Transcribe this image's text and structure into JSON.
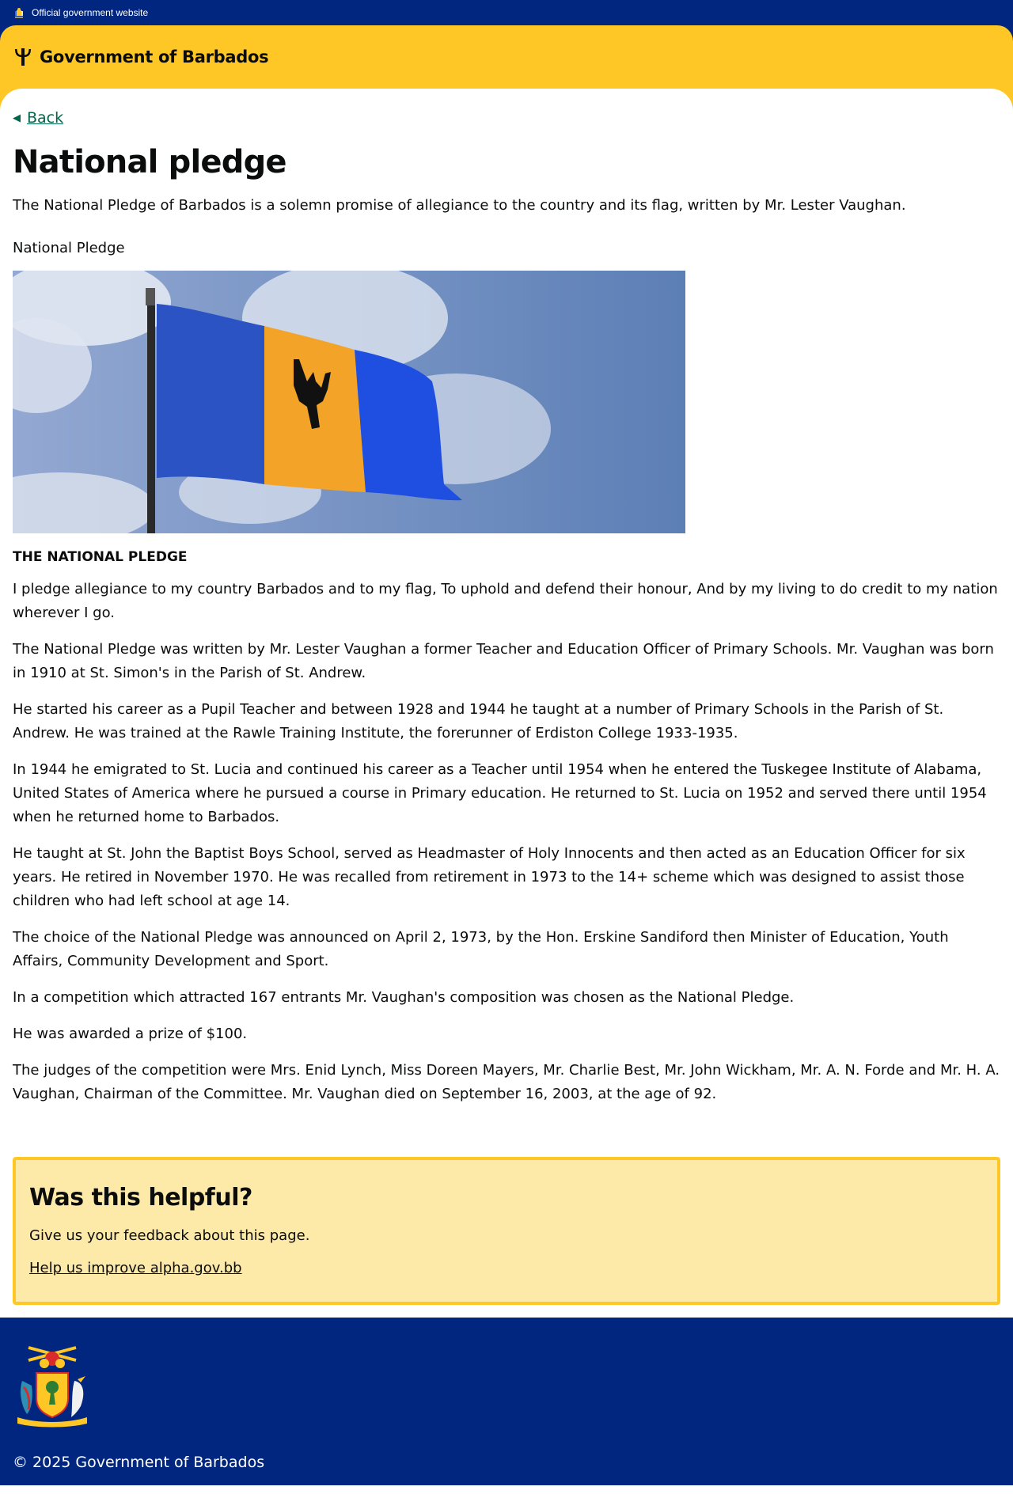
{
  "topbar": {
    "label": "Official government website",
    "crest_icon": "coat-of-arms-icon"
  },
  "header": {
    "brand": "Government of Barbados",
    "icon": "trident-icon"
  },
  "nav": {
    "back_label": "Back"
  },
  "page": {
    "title": "National pledge",
    "lead": "The National Pledge of Barbados is a solemn promise of allegiance to the country and its flag, written by Mr. Lester Vaughan.",
    "image_caption": "National Pledge",
    "pledge_heading": "THE NATIONAL PLEDGE",
    "paragraphs": [
      "I pledge allegiance to my country Barbados and to my flag, To uphold and defend their honour, And by my living to do credit to my nation wherever I go.",
      "The National Pledge was written by Mr. Lester Vaughan a former Teacher and Education Officer of Primary Schools. Mr. Vaughan was born in 1910 at St. Simon's in the Parish of St. Andrew.",
      "He started his career as a Pupil Teacher and between 1928 and 1944 he taught at a number of Primary Schools in the Parish of St. Andrew. He was trained at the Rawle Training Institute, the forerunner of Erdiston College 1933-1935.",
      "In 1944 he emigrated to St. Lucia and continued his career as a Teacher until 1954 when he entered the Tuskegee Institute of Alabama, United States of America where he pursued a course in Primary education. He returned to St. Lucia on 1952 and served there until 1954 when he returned home to Barbados.",
      "He taught at St. John the Baptist Boys School, served as Headmaster of Holy Innocents and then acted as an Education Officer for six years. He retired in November 1970. He was recalled from retirement in 1973 to the 14+ scheme which was designed to assist those children who had left school at age 14.",
      "The choice of the National Pledge was announced on April 2, 1973, by the Hon. Erskine Sandiford then Minister of Education, Youth Affairs, Community Development and Sport.",
      "In a competition which attracted 167 entrants Mr. Vaughan's composition was chosen as the National Pledge.",
      "He was awarded a prize of $100.",
      "The judges of the competition were Mrs. Enid Lynch, Miss Doreen Mayers, Mr. Charlie Best, Mr. John Wickham, Mr. A. N. Forde and Mr. H. A. Vaughan, Chairman of the Committee. Mr. Vaughan died on September 16, 2003, at the age of 92."
    ]
  },
  "feedback": {
    "title": "Was this helpful?",
    "text": "Give us your feedback about this page.",
    "link": "Help us improve alpha.gov.bb"
  },
  "footer": {
    "copyright": "© 2025 Government of Barbados",
    "coat_icon": "coat-of-arms-icon"
  },
  "colors": {
    "navy": "#00267f",
    "gold": "#ffc726",
    "feedback_bg": "#feeaa8",
    "link_green": "#00654a"
  }
}
